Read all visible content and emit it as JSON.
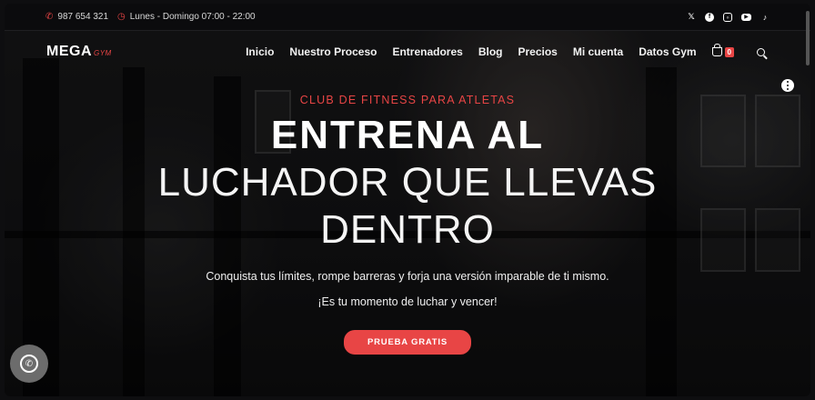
{
  "topbar": {
    "phone": "987 654 321",
    "hours": "Lunes - Domingo 07:00 - 22:00",
    "socials": [
      "x-icon",
      "facebook-icon",
      "instagram-icon",
      "youtube-icon",
      "tiktok-icon"
    ]
  },
  "logo": {
    "main": "MEGA",
    "accent": "GYM"
  },
  "nav": {
    "items": [
      "Inicio",
      "Nuestro Proceso",
      "Entrenadores",
      "Blog",
      "Precios",
      "Mi cuenta",
      "Datos Gym"
    ],
    "cart_count": "0"
  },
  "hero": {
    "kicker": "CLUB DE FITNESS PARA ATLETAS",
    "title_bold": "ENTRENA AL",
    "title_light_1": "LUCHADOR QUE LLEVAS",
    "title_light_2": "DENTRO",
    "subtitle": "Conquista tus límites, rompe barreras y forja una versión imparable de ti mismo.",
    "subtitle_2": "¡Es tu momento de luchar y vencer!",
    "cta": "PRUEBA GRATIS"
  },
  "colors": {
    "accent": "#e84545",
    "background": "#0e0e10"
  }
}
